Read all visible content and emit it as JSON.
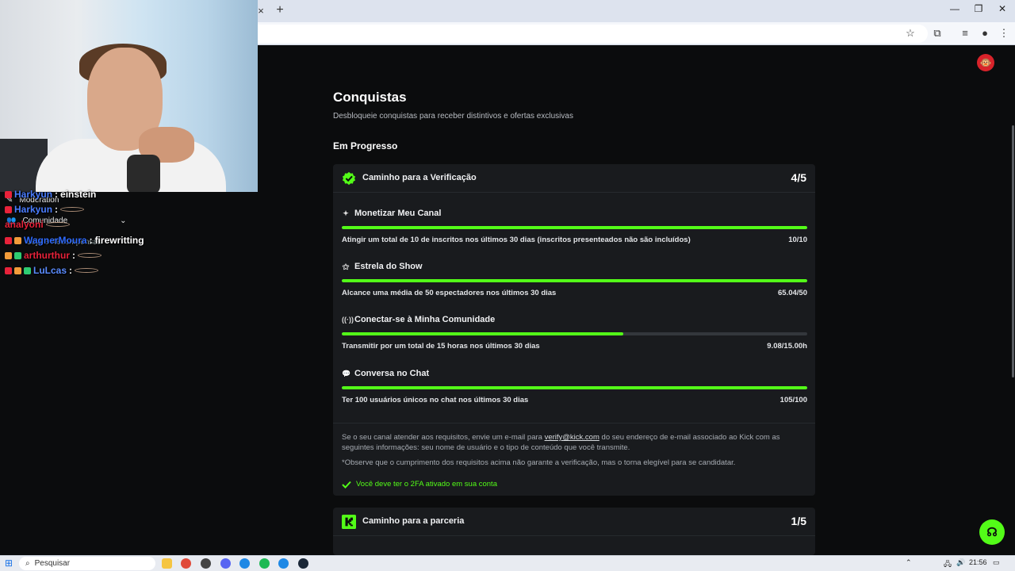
{
  "browser": {
    "new_tab_symbol": "+",
    "close_tab_symbol": "×",
    "window_controls": [
      "—",
      "❐",
      "✕"
    ]
  },
  "page": {
    "title": "Conquistas",
    "subtitle": "Desbloqueie conquistas para receber distintivos e ofertas exclusivas",
    "section_title": "Em Progresso",
    "accent_color": "#53fc18"
  },
  "verification_card": {
    "title": "Caminho para a Verificação",
    "count": "4/5",
    "requirements": [
      {
        "icon": "sparkle-icon",
        "title": "Monetizar Meu Canal",
        "desc": "Atingir um total de 10 de inscritos nos últimos 30 dias (inscritos presenteados não são incluídos)",
        "value": "10/10",
        "progress": 1.0
      },
      {
        "icon": "star-person-icon",
        "title": "Estrela do Show",
        "desc": "Alcance uma média de 50 espectadores nos últimos 30 dias",
        "value": "65.04/50",
        "progress": 1.0
      },
      {
        "icon": "broadcast-icon",
        "title": "Conectar-se à Minha Comunidade",
        "desc": "Transmitir por um total de 15 horas nos últimos 30 dias",
        "value": "9.08/15.00h",
        "progress": 0.605
      },
      {
        "icon": "chat-bubble-icon",
        "title": "Conversa no Chat",
        "desc": "Ter 100 usuários únicos no chat nos últimos 30 dias",
        "value": "105/100",
        "progress": 1.0
      }
    ],
    "note_before_link": "Se o seu canal atender aos requisitos, envie um e-mail para ",
    "note_link": "verify@kick.com",
    "note_after_link": " do seu endereço de e-mail associado ao Kick com as seguintes informações: seu nome de usuário e o tipo de conteúdo que você transmite.",
    "disclaimer": "*Observe que o cumprimento dos requisitos acima não garante a verificação, mas o torna elegível para se candidatar.",
    "check_text": "Você deve ter o 2FA ativado em sua conta"
  },
  "partner_card": {
    "title": "Caminho para a parceria",
    "count": "1/5"
  },
  "sidebar_overlay": {
    "moderation": "Moderation",
    "community": "Comunidade",
    "rewards": "Loja e Recompensas"
  },
  "chat": [
    {
      "user": "Harkyun",
      "user_color": "#4a7dff",
      "message": "einstein"
    },
    {
      "user": "Harkyun",
      "user_color": "#4a7dff",
      "message": ""
    },
    {
      "user": "analyoni",
      "user_color": "#e8223a",
      "message": ""
    },
    {
      "user": "WagnerMoura",
      "user_color": "#2f6bff",
      "message": "firewritting"
    },
    {
      "user": "arthurthur",
      "user_color": "#e8223a",
      "message": ""
    },
    {
      "user": "LuLcas",
      "user_color": "#5b8cff",
      "message": ""
    }
  ],
  "taskbar": {
    "search_placeholder": "Pesquisar",
    "time": "21:56"
  }
}
